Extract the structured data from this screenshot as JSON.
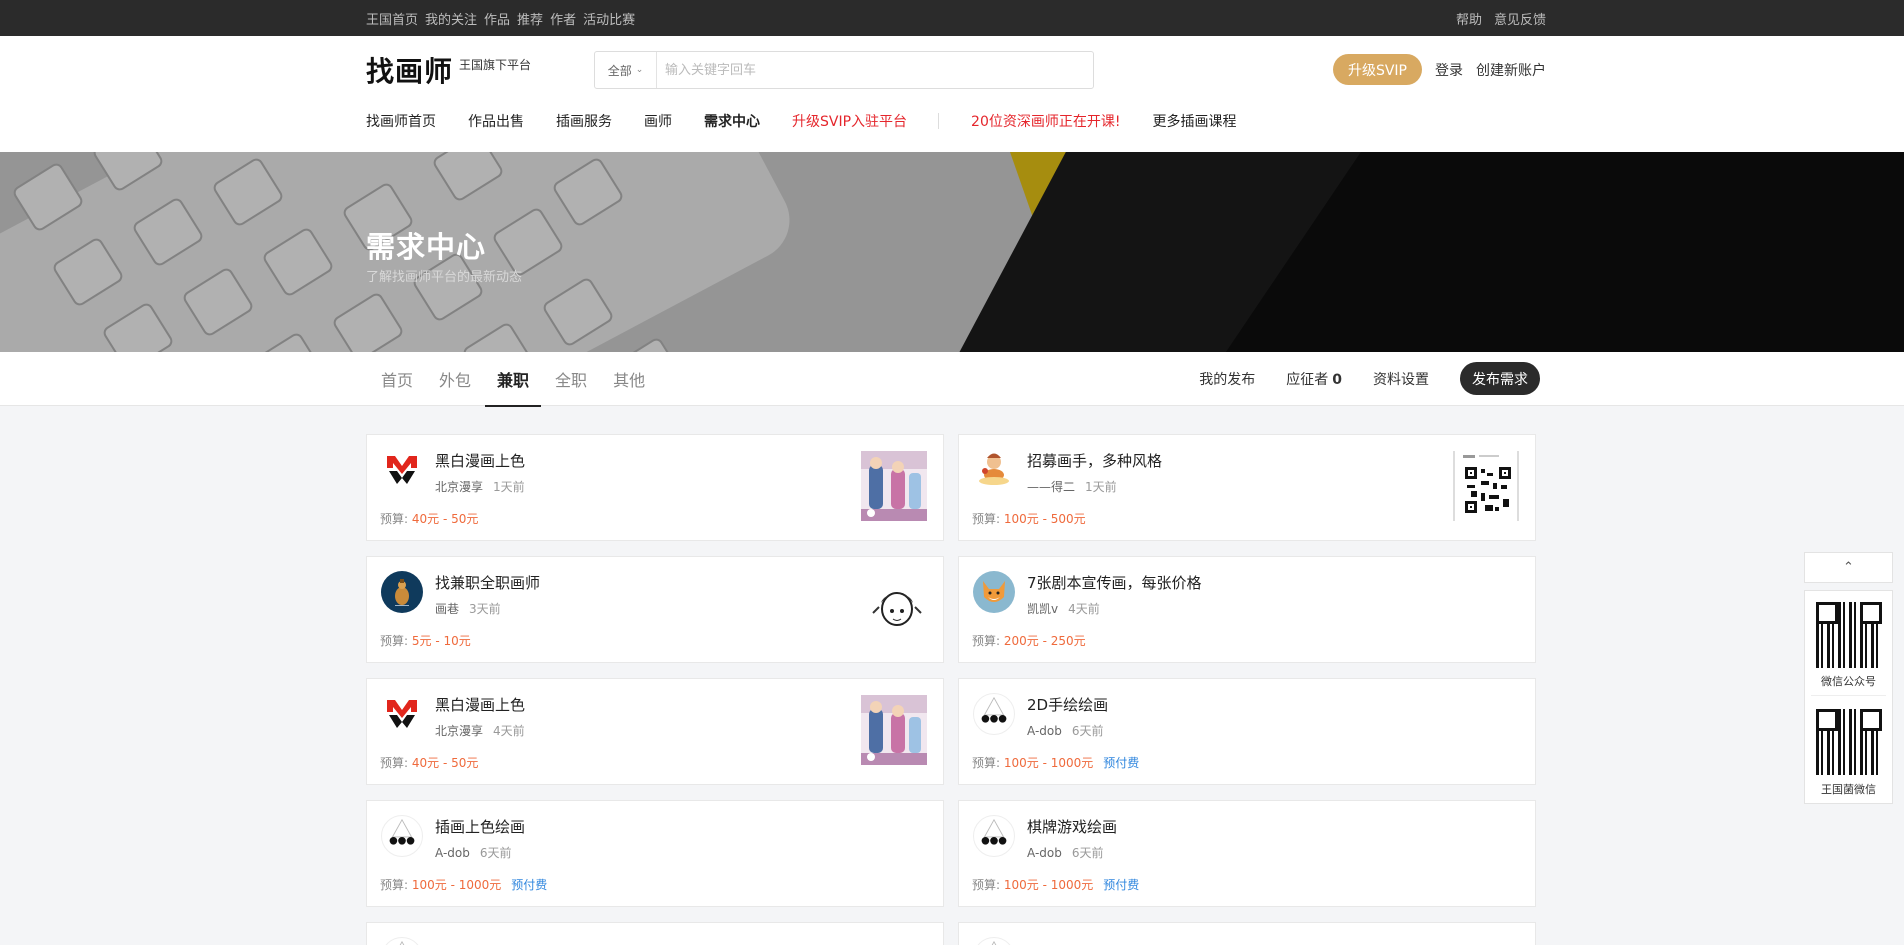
{
  "topbar": {
    "links": [
      "王国首页",
      "我的关注",
      "作品",
      "推荐",
      "作者",
      "活动比赛"
    ],
    "right_links": [
      "帮助",
      "意见反馈"
    ]
  },
  "header": {
    "logo_main": "找画师",
    "logo_sub": "王国旗下平台",
    "search_scope": "全部",
    "search_placeholder": "输入关键字回车",
    "svip_button": "升级SVIP",
    "login": "登录",
    "register": "创建新账户",
    "nav": [
      {
        "label": "找画师首页",
        "style": "normal"
      },
      {
        "label": "作品出售",
        "style": "normal"
      },
      {
        "label": "插画服务",
        "style": "normal"
      },
      {
        "label": "画师",
        "style": "normal"
      },
      {
        "label": "需求中心",
        "style": "active"
      },
      {
        "label": "升级SVIP入驻平台",
        "style": "red"
      },
      {
        "label": "20位资深画师正在开课!",
        "style": "red"
      },
      {
        "label": "更多插画课程",
        "style": "normal"
      }
    ]
  },
  "banner": {
    "title": "需求中心",
    "subtitle": "了解找画师平台的最新动态"
  },
  "subnav": {
    "tabs": [
      "首页",
      "外包",
      "兼职",
      "全职",
      "其他"
    ],
    "active_tab": "兼职",
    "my_posts": "我的发布",
    "applicants_label": "应征者",
    "applicants_count": "0",
    "profile_settings": "资料设置",
    "publish_button": "发布需求"
  },
  "budget_label": "预算:",
  "cards": [
    {
      "title": "黑白漫画上色",
      "author": "北京漫享",
      "time": "1天前",
      "budget": "40元 - 50元",
      "prepay": "",
      "avatar": "m-logo",
      "thumb": "comic"
    },
    {
      "title": "招募画手，多种风格",
      "author": "——得二",
      "time": "1天前",
      "budget": "100元 - 500元",
      "prepay": "",
      "avatar": "cartoon",
      "thumb": "qr"
    },
    {
      "title": "找兼职全职画师",
      "author": "画巷",
      "time": "3天前",
      "budget": "5元 - 10元",
      "prepay": "",
      "avatar": "navy",
      "thumb": "sketch"
    },
    {
      "title": "7张剧本宣传画，每张价格",
      "author": "凯凯v",
      "time": "4天前",
      "budget": "200元 - 250元",
      "prepay": "",
      "avatar": "fox",
      "thumb": ""
    },
    {
      "title": "黑白漫画上色",
      "author": "北京漫享",
      "time": "4天前",
      "budget": "40元 - 50元",
      "prepay": "",
      "avatar": "m-logo",
      "thumb": "comic"
    },
    {
      "title": "2D手绘绘画",
      "author": "A-dob",
      "time": "6天前",
      "budget": "100元 - 1000元",
      "prepay": "预付费",
      "avatar": "dots",
      "thumb": ""
    },
    {
      "title": "插画上色绘画",
      "author": "A-dob",
      "time": "6天前",
      "budget": "100元 - 1000元",
      "prepay": "预付费",
      "avatar": "dots",
      "thumb": ""
    },
    {
      "title": "棋牌游戏绘画",
      "author": "A-dob",
      "time": "6天前",
      "budget": "100元 - 1000元",
      "prepay": "预付费",
      "avatar": "dots",
      "thumb": ""
    }
  ],
  "float": {
    "top_icon": "chevron-up-icon",
    "qr1_caption": "微信公众号",
    "qr2_caption": "王国菌微信"
  },
  "colors": {
    "accent_gold": "#d8a961",
    "budget_orange": "#ef6a3c",
    "prepay_blue": "#2f86de",
    "nav_red": "#e5262c",
    "topbar_bg": "#2b2b2b"
  }
}
